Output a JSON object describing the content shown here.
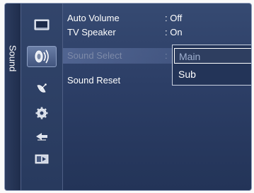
{
  "tab": {
    "label": "Sound"
  },
  "icons": [
    "picture-icon",
    "sound-icon",
    "channel-icon",
    "setup-icon",
    "input-icon",
    "application-icon"
  ],
  "menu": {
    "auto_volume": {
      "label": "Auto Volume",
      "value": ": Off"
    },
    "tv_speaker": {
      "label": "TV Speaker",
      "value": ": On"
    },
    "sound_select": {
      "label": "Sound Select",
      "value": ":"
    },
    "sound_reset": {
      "label": "Sound Reset"
    }
  },
  "dropdown": {
    "options": [
      "Main",
      "Sub"
    ],
    "selected": "Main"
  },
  "colors": {
    "panel": "#2c3e66",
    "text": "#ffffff",
    "dim_text": "#7d8aa8",
    "dropdown_border": "#c8d0e0"
  }
}
